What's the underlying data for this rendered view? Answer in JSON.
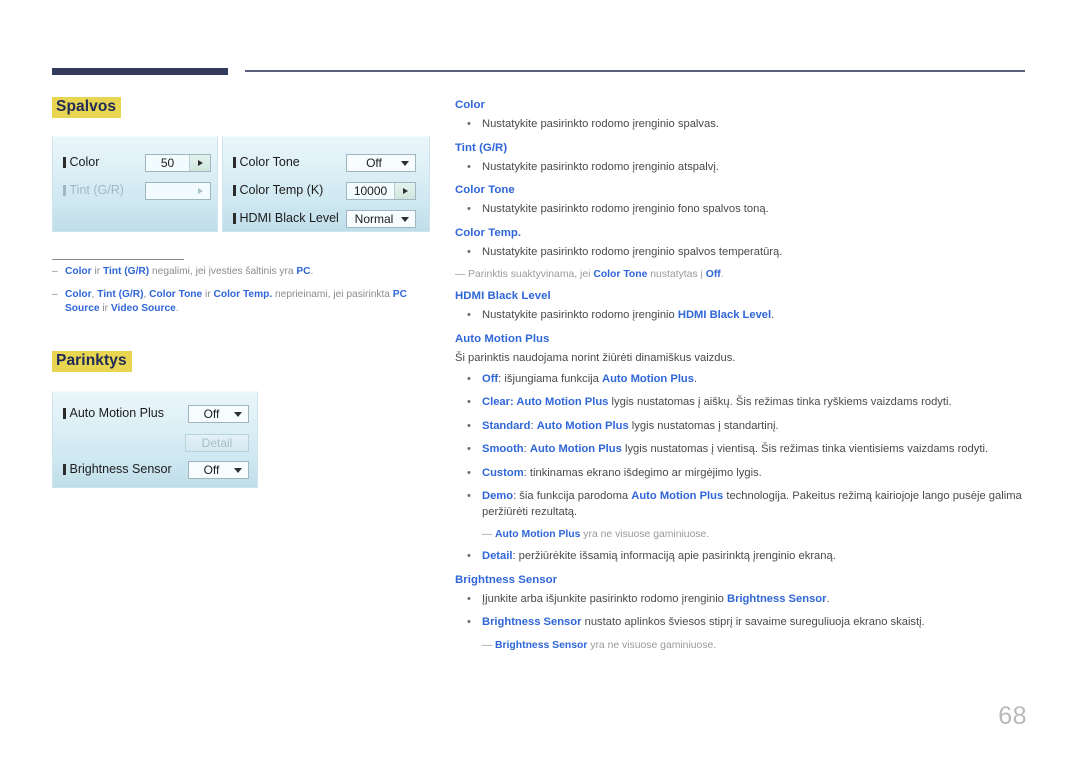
{
  "page": {
    "number": "68"
  },
  "sections": {
    "colors": {
      "title": "Spalvos"
    },
    "options": {
      "title": "Parinktys"
    }
  },
  "osd_colors": {
    "panel1": {
      "rows": [
        {
          "label": "Color",
          "value": "50",
          "control": "spin",
          "disabled": false
        },
        {
          "label": "Tint (G/R)",
          "value": "",
          "control": "spin",
          "disabled": true
        }
      ]
    },
    "panel2": {
      "rows": [
        {
          "label": "Color Tone",
          "value": "Off",
          "control": "dropdown",
          "disabled": false
        },
        {
          "label": "Color Temp (K)",
          "value": "10000",
          "control": "spin",
          "disabled": false
        },
        {
          "label": "HDMI Black Level",
          "value": "Normal",
          "control": "dropdown",
          "disabled": false
        }
      ]
    }
  },
  "osd_options": {
    "rows": [
      {
        "label": "Auto Motion Plus",
        "value": "Off",
        "control": "dropdown"
      },
      {
        "label": "Brightness Sensor",
        "value": "Off",
        "control": "dropdown"
      }
    ],
    "detail_button": "Detail"
  },
  "left_notes": [
    {
      "segments": [
        {
          "t": "Color",
          "b": true
        },
        {
          "t": " ir ",
          "b": false
        },
        {
          "t": "Tint (G/R)",
          "b": true
        },
        {
          "t": " negalimi, jei įvesties šaltinis yra ",
          "b": false
        },
        {
          "t": "PC",
          "b": true
        },
        {
          "t": ".",
          "b": false
        }
      ]
    },
    {
      "segments": [
        {
          "t": "Color",
          "b": true
        },
        {
          "t": ", ",
          "b": false
        },
        {
          "t": "Tint (G/R)",
          "b": true
        },
        {
          "t": ", ",
          "b": false
        },
        {
          "t": "Color Tone",
          "b": true
        },
        {
          "t": " ir ",
          "b": false
        },
        {
          "t": "Color Temp.",
          "b": true
        },
        {
          "t": " neprieinami, jei pasirinkta ",
          "b": false
        },
        {
          "t": "PC Source",
          "b": true
        },
        {
          "t": " ir ",
          "b": false
        },
        {
          "t": "Video Source",
          "b": true
        },
        {
          "t": ".",
          "b": false
        }
      ]
    }
  ],
  "right_column": [
    {
      "type": "heading",
      "text": "Color"
    },
    {
      "type": "bullet",
      "segments": [
        {
          "t": "Nustatykite pasirinkto rodomo įrenginio spalvas.",
          "b": false
        }
      ]
    },
    {
      "type": "heading",
      "text": "Tint (G/R)"
    },
    {
      "type": "bullet",
      "segments": [
        {
          "t": "Nustatykite pasirinkto rodomo įrenginio atspalvį.",
          "b": false
        }
      ]
    },
    {
      "type": "heading",
      "text": "Color Tone"
    },
    {
      "type": "bullet",
      "segments": [
        {
          "t": "Nustatykite pasirinkto rodomo įrenginio fono spalvos toną.",
          "b": false
        }
      ]
    },
    {
      "type": "heading",
      "text": "Color Temp."
    },
    {
      "type": "bullet",
      "segments": [
        {
          "t": "Nustatykite pasirinkto rodomo įrenginio spalvos temperatūrą.",
          "b": false
        }
      ]
    },
    {
      "type": "note",
      "segments": [
        {
          "t": "Parinktis suaktyvinama, jei ",
          "b": false
        },
        {
          "t": "Color Tone",
          "b": true
        },
        {
          "t": " nustatytas į ",
          "b": false
        },
        {
          "t": "Off",
          "b": true
        },
        {
          "t": ".",
          "b": false
        }
      ]
    },
    {
      "type": "heading",
      "text": "HDMI Black Level"
    },
    {
      "type": "bullet",
      "segments": [
        {
          "t": "Nustatykite pasirinkto rodomo įrenginio ",
          "b": false
        },
        {
          "t": "HDMI Black Level",
          "b": true
        },
        {
          "t": ".",
          "b": false
        }
      ]
    },
    {
      "type": "heading",
      "text": "Auto Motion Plus"
    },
    {
      "type": "plain",
      "segments": [
        {
          "t": "Ši parinktis naudojama norint žiūrėti dinamiškus vaizdus.",
          "b": false
        }
      ]
    },
    {
      "type": "bullet",
      "segments": [
        {
          "t": "Off",
          "b": true
        },
        {
          "t": ": išjungiama funkcija ",
          "b": false
        },
        {
          "t": "Auto Motion Plus",
          "b": true
        },
        {
          "t": ".",
          "b": false
        }
      ]
    },
    {
      "type": "bullet",
      "segments": [
        {
          "t": "Clear",
          "b": true
        },
        {
          "t": ": ",
          "b": true
        },
        {
          "t": "Auto Motion Plus",
          "b": true
        },
        {
          "t": " lygis nustatomas į aiškų. Šis režimas tinka ryškiems vaizdams rodyti.",
          "b": false
        }
      ]
    },
    {
      "type": "bullet",
      "segments": [
        {
          "t": "Standard",
          "b": true
        },
        {
          "t": ": ",
          "b": false
        },
        {
          "t": "Auto Motion Plus",
          "b": true
        },
        {
          "t": " lygis nustatomas į standartinį.",
          "b": false
        }
      ]
    },
    {
      "type": "bullet",
      "segments": [
        {
          "t": "Smooth",
          "b": true
        },
        {
          "t": ": ",
          "b": false
        },
        {
          "t": "Auto Motion Plus",
          "b": true
        },
        {
          "t": " lygis nustatomas į vientisą. Šis režimas tinka vientisiems vaizdams rodyti.",
          "b": false
        }
      ]
    },
    {
      "type": "bullet",
      "segments": [
        {
          "t": "Custom",
          "b": true
        },
        {
          "t": ": tinkinamas ekrano išdegimo ar mirgėjimo lygis.",
          "b": false
        }
      ]
    },
    {
      "type": "bullet",
      "segments": [
        {
          "t": "Demo",
          "b": true
        },
        {
          "t": ": šia funkcija parodoma ",
          "b": false
        },
        {
          "t": "Auto Motion Plus",
          "b": true
        },
        {
          "t": " technologija. Pakeitus režimą kairiojoje lango pusėje galima peržiūrėti rezultatą.",
          "b": false
        }
      ]
    },
    {
      "type": "note-indent",
      "segments": [
        {
          "t": "Auto Motion Plus",
          "b": true
        },
        {
          "t": " yra ne visuose gaminiuose.",
          "b": false
        }
      ]
    },
    {
      "type": "bullet",
      "segments": [
        {
          "t": "Detail",
          "b": true
        },
        {
          "t": ": peržiūrėkite išsamią informaciją apie pasirinktą įrenginio ekraną.",
          "b": false
        }
      ]
    },
    {
      "type": "heading",
      "text": "Brightness Sensor"
    },
    {
      "type": "bullet",
      "segments": [
        {
          "t": "Įjunkite arba išjunkite pasirinkto rodomo įrenginio ",
          "b": false
        },
        {
          "t": "Brightness Sensor",
          "b": true
        },
        {
          "t": ".",
          "b": false
        }
      ]
    },
    {
      "type": "bullet",
      "segments": [
        {
          "t": "Brightness Sensor",
          "b": true
        },
        {
          "t": " nustato aplinkos šviesos stiprį ir savaime sureguliuoja ekrano skaistį.",
          "b": false
        }
      ]
    },
    {
      "type": "note-indent",
      "segments": [
        {
          "t": "Brightness Sensor",
          "b": true
        },
        {
          "t": " yra ne visuose gaminiuose.",
          "b": false
        }
      ]
    }
  ],
  "colors": {
    "accent_blue": "#2f66d8",
    "highlight_yellow": "#e8d552",
    "header_navy": "#333a5c",
    "panel_top": "#eaf7fb",
    "panel_bottom": "#bfdde9"
  }
}
